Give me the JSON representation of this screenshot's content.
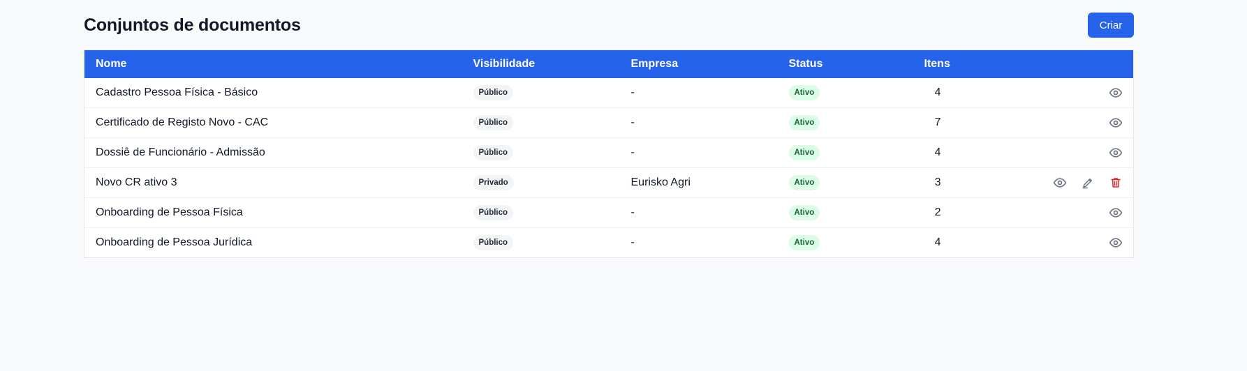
{
  "header": {
    "title": "Conjuntos de documentos",
    "create_label": "Criar"
  },
  "table": {
    "columns": [
      "Nome",
      "Visibilidade",
      "Empresa",
      "Status",
      "Itens"
    ],
    "rows": [
      {
        "name": "Cadastro Pessoa Física - Básico",
        "visibility": "Público",
        "company": "-",
        "status": "Ativo",
        "items": "4",
        "actions": [
          "view"
        ]
      },
      {
        "name": "Certificado de Registo Novo - CAC",
        "visibility": "Público",
        "company": "-",
        "status": "Ativo",
        "items": "7",
        "actions": [
          "view"
        ]
      },
      {
        "name": "Dossiê de Funcionário - Admissão",
        "visibility": "Público",
        "company": "-",
        "status": "Ativo",
        "items": "4",
        "actions": [
          "view"
        ]
      },
      {
        "name": "Novo CR ativo 3",
        "visibility": "Privado",
        "company": "Eurisko Agri",
        "status": "Ativo",
        "items": "3",
        "actions": [
          "view",
          "edit",
          "delete"
        ]
      },
      {
        "name": "Onboarding de Pessoa Física",
        "visibility": "Público",
        "company": "-",
        "status": "Ativo",
        "items": "2",
        "actions": [
          "view"
        ]
      },
      {
        "name": "Onboarding de Pessoa Jurídica",
        "visibility": "Público",
        "company": "-",
        "status": "Ativo",
        "items": "4",
        "actions": [
          "view"
        ]
      }
    ]
  },
  "icons": {
    "view": "eye-icon",
    "edit": "pencil-icon",
    "delete": "trash-icon"
  },
  "colors": {
    "primary": "#2563eb",
    "status_bg": "#dcfce7",
    "status_text": "#166534",
    "delete": "#dc2626",
    "icon": "#6b7280"
  }
}
